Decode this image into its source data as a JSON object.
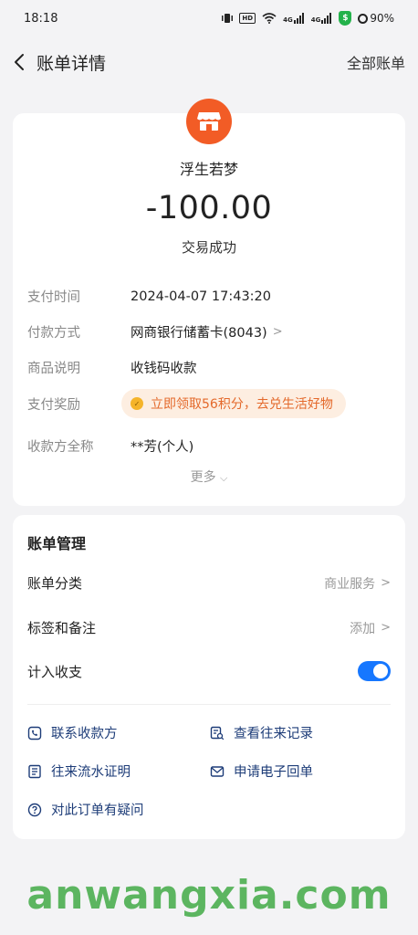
{
  "status_bar": {
    "time": "18:18",
    "battery": "90%",
    "signal1": "4G",
    "signal2": "4G",
    "hd": "HD"
  },
  "nav": {
    "title": "账单详情",
    "right_action": "全部账单"
  },
  "bill": {
    "merchant": "浮生若梦",
    "amount": "-100.00",
    "status": "交易成功",
    "rows": [
      {
        "label": "支付时间",
        "value": "2024-04-07 17:43:20"
      },
      {
        "label": "付款方式",
        "value": "网商银行储蓄卡(8043)"
      },
      {
        "label": "商品说明",
        "value": "收钱码收款"
      },
      {
        "label": "支付奖励",
        "value": "立即领取56积分，去兑生活好物"
      },
      {
        "label": "收款方全称",
        "value": "**芳(个人)"
      }
    ],
    "more_label": "更多"
  },
  "management": {
    "title": "账单管理",
    "category_label": "账单分类",
    "category_value": "商业服务",
    "tags_label": "标签和备注",
    "tags_value": "添加",
    "count_label": "计入收支",
    "count_enabled": true,
    "links": {
      "contact": "联系收款方",
      "history": "查看往来记录",
      "statement": "往来流水证明",
      "receipt": "申请电子回单",
      "question": "对此订单有疑问"
    }
  },
  "watermark": "anwangxia.com",
  "colors": {
    "accent": "#1677ff",
    "merchant_icon": "#f25c26",
    "reward_text": "#e4692b",
    "watermark": "#4caf50"
  }
}
